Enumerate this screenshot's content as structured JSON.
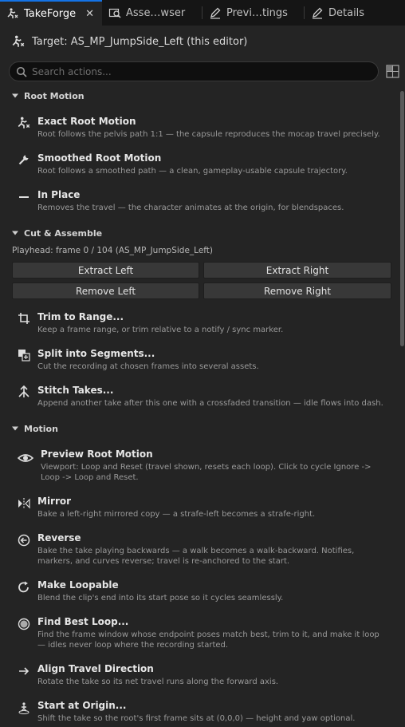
{
  "tabs": [
    {
      "label": "TakeForge",
      "icon": "takeforge-icon",
      "active": true,
      "close": "✕"
    },
    {
      "label": "Asse…wser",
      "icon": "asset-browser-icon",
      "active": false
    },
    {
      "label": "Previ…tings",
      "icon": "pencil-icon",
      "active": false
    },
    {
      "label": "Details",
      "icon": "pencil-icon",
      "active": false
    }
  ],
  "target": {
    "label": "Target: AS_MP_JumpSide_Left (this editor)"
  },
  "search": {
    "placeholder": "Search actions..."
  },
  "sections": {
    "root_motion": "Root Motion",
    "cut_assemble": "Cut & Assemble",
    "motion": "Motion"
  },
  "root_motion_items": [
    {
      "title": "Exact Root Motion",
      "desc": "Root follows the pelvis path 1:1 — the capsule reproduces the mocap travel precisely."
    },
    {
      "title": "Smoothed Root Motion",
      "desc": "Root follows a smoothed path — a clean, gameplay-usable capsule trajectory."
    },
    {
      "title": "In Place",
      "desc": "Removes the travel — the character animates at the origin, for blendspaces."
    }
  ],
  "cut": {
    "playhead": "Playhead: frame 0 / 104  (AS_MP_JumpSide_Left)",
    "extract_left": "Extract Left",
    "extract_right": "Extract Right",
    "remove_left": "Remove Left",
    "remove_right": "Remove Right"
  },
  "cut_items": [
    {
      "title": "Trim to Range...",
      "desc": "Keep a frame range, or trim relative to a notify / sync marker."
    },
    {
      "title": "Split into Segments...",
      "desc": "Cut the recording at chosen frames into several assets."
    },
    {
      "title": "Stitch Takes...",
      "desc": "Append another take after this one with a crossfaded transition — idle flows into dash."
    }
  ],
  "motion_items": [
    {
      "title": "Preview Root Motion",
      "desc": "Viewport: Loop and Reset (travel shown, resets each loop). Click to cycle Ignore -> Loop -> Loop and Reset."
    },
    {
      "title": "Mirror",
      "desc": "Bake a left-right mirrored copy — a strafe-left becomes a strafe-right."
    },
    {
      "title": "Reverse",
      "desc": "Bake the take playing backwards — a walk becomes a walk-backward. Notifies, markers, and curves reverse; travel is re-anchored to the start."
    },
    {
      "title": "Make Loopable",
      "desc": "Blend the clip's end into its start pose so it cycles seamlessly."
    },
    {
      "title": "Find Best Loop...",
      "desc": "Find the frame window whose endpoint poses match best, trim to it, and make it loop — idles never loop where the recording started."
    },
    {
      "title": "Align Travel Direction",
      "desc": "Rotate the take so its net travel runs along the forward axis."
    },
    {
      "title": "Start at Origin...",
      "desc": "Shift the take so the root's first frame sits at (0,0,0) — height and yaw optional."
    }
  ],
  "colors": {
    "accent": "#1473e6",
    "background": "#242424",
    "tabbar": "#151515"
  }
}
